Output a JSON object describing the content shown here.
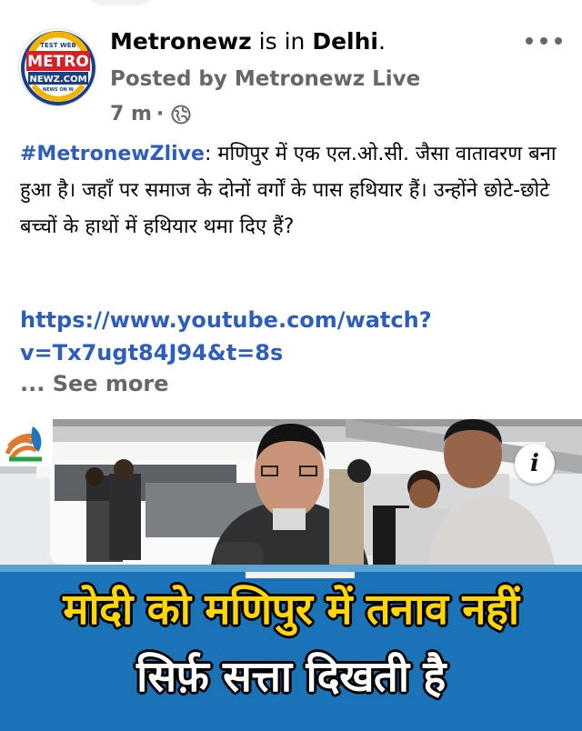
{
  "post": {
    "author": "Metronewz",
    "location_prefix": " is in ",
    "location": "Delhi",
    "location_suffix": ".",
    "posted_by": "Posted by Metronewz Live",
    "time": "7 m",
    "dot": "·",
    "hashtag": "#MetronewZlive",
    "body": ": मणिपुर में एक एल.ओ.सी. जैसा वातावरण बना हुआ है। जहाँ पर समाज के दोनों वर्गों के पास हथियार हैं। उन्होंने छोटे-छोटे बच्चों के हाथों में हथियार थमा दिए हैं?",
    "link": "https://www.youtube.com/watch?v=Tx7ugt84J94&t=8s",
    "see_more": "... See more"
  },
  "avatar": {
    "top_text": "TEST WEB",
    "main_text": "METRO",
    "sub_text": "NEWZ.COM",
    "bottom_text": "NEWS ON W"
  },
  "media": {
    "headline_line1": "मोदी को मणिपुर में तनाव नहीं",
    "headline_line2": "सिर्फ़ सत्ता दिखती है",
    "info_label": "i"
  },
  "icons": {
    "more": "more-horizontal-icon",
    "globe": "globe-icon",
    "info": "info-icon",
    "party_logo": "congress-hand-logo"
  },
  "colors": {
    "link": "#2d5ebd",
    "muted": "#65676b",
    "banner_blue": "#1b73b7",
    "headline_yellow": "#ffd700"
  }
}
